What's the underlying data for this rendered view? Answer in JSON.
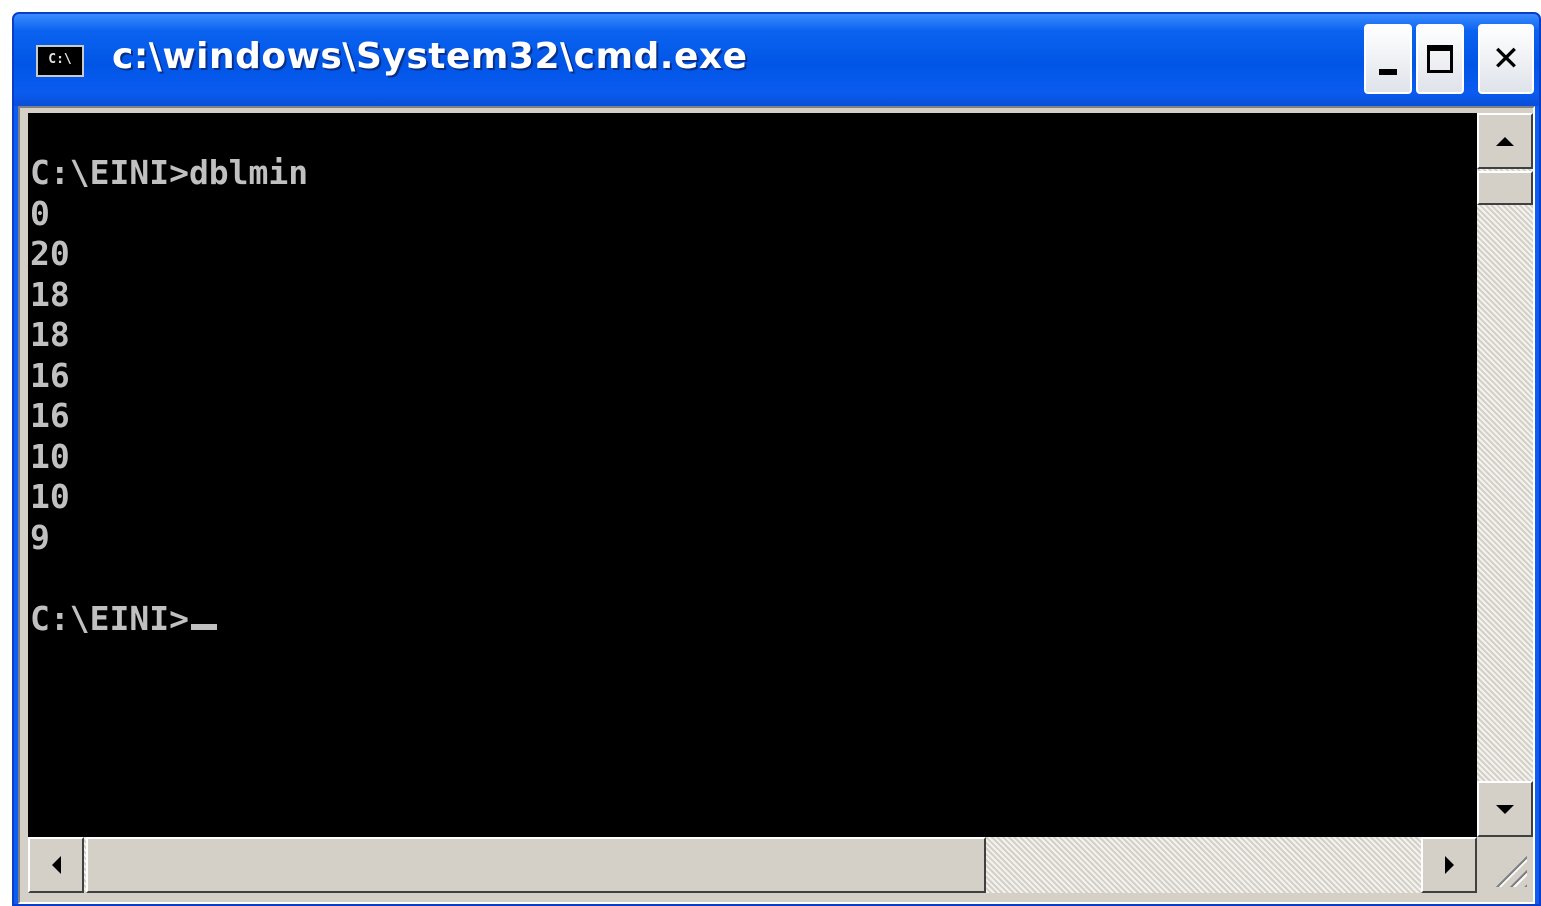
{
  "window": {
    "title": "c:\\windows\\System32\\cmd.exe",
    "icon_text": "C:\\",
    "icon": "console-app-icon",
    "controls": {
      "minimize_icon": "minimize-icon",
      "maximize_icon": "maximize-icon",
      "close_icon": "close-icon",
      "close_glyph": "✕"
    }
  },
  "console": {
    "lines": [
      "C:\\EINI>dblmin",
      "0",
      "20",
      "18",
      "18",
      "16",
      "16",
      "10",
      "10",
      "9",
      "",
      "C:\\EINI>"
    ],
    "text_color": "#c0c0c0",
    "background": "#000000"
  },
  "colors": {
    "titlebar": "#0055e6",
    "frame": "#d4d0c8"
  }
}
